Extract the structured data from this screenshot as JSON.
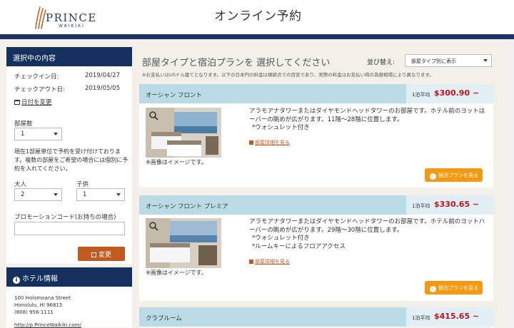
{
  "brand": {
    "name": "PRINCE",
    "sub": "WAIKIKI"
  },
  "header": {
    "title": "オンライン予約"
  },
  "sidebar": {
    "selection_title": "選択中の内容",
    "checkin_label": "チェックイン日:",
    "checkin_value": "2019/04/27",
    "checkout_label": "チェックアウト日:",
    "checkout_value": "2019/05/05",
    "change_dates_link": "日付を変更",
    "rooms_label": "部屋数",
    "rooms_value": "1",
    "rooms_note": "現在1部屋単位で予約を受け付けております。複数の部屋をご希望の場合には個別に予約を入れてください。",
    "adults_label": "大人",
    "adults_value": "2",
    "children_label": "子供",
    "children_value": "1",
    "promo_label": "プロモーションコード(お持ちの場合)",
    "promo_value": "",
    "change_button": "変更",
    "hotel_info_title": "ホテル情報",
    "address_line1": "100 Holomoana Street",
    "address_line2": "Honolulu, HI 96815",
    "phone": "(808) 956-1111",
    "website": "http://p.PrinceWaikiki.com/"
  },
  "main": {
    "title": "部屋タイプと宿泊プランを 選択してください",
    "sort_label": "並び替え:",
    "sort_value": "部屋タイプ別に表示",
    "disclaimer": "※お支払いはUSドル建てとなります。以下の日本円の料金は規締点での目安であり、実際の料金はお支払い時の為替相場により異なります。",
    "price_prefix": "1泊平均",
    "photo_caption": "※画像はイメージです。",
    "map_link": "部屋詳細を見る",
    "plan_button": "宿泊プランを見る",
    "rooms": [
      {
        "name": "オーシャン フロント",
        "price": "$300.90 ~",
        "desc": "アラモアナタワーまたはダイヤモンドヘッドタワーのお部屋です。ホテル前のヨットはーバーの眺めが広がります。11階～28階に位置します。",
        "features": [
          "*ウォシュレット付き"
        ]
      },
      {
        "name": "オーシャン フロント プレミア",
        "price": "$330.65 ~",
        "desc": "アラモアナタワーまたはダイヤモンドヘッドタワーのお部屋です。ホテル前のヨットハーバーの眺めが広がります。29階～30階に位置します。",
        "features": [
          "*ウォシュレット付き",
          "*ルームキーによるフロアアクセス"
        ]
      },
      {
        "name": "クラブルーム",
        "price": "$415.65 ~"
      }
    ]
  },
  "colors": {
    "navy": "#13315c",
    "accent_orange": "#c05a20",
    "button_orange": "#f39a12",
    "price_red": "#c3121e",
    "card_header": "#b9dbe6"
  }
}
